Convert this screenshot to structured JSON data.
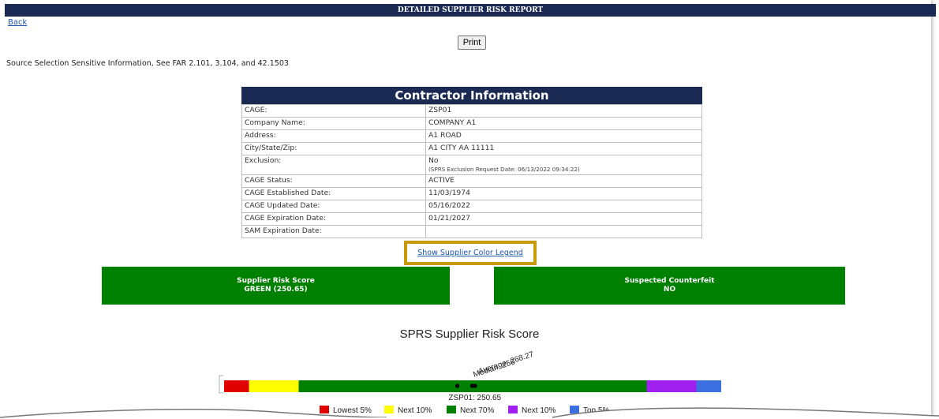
{
  "header": {
    "title": "DETAILED SUPPLIER RISK REPORT"
  },
  "nav": {
    "back_label": "Back",
    "print_label": "Print"
  },
  "notice": "Source Selection Sensitive Information, See FAR 2.101, 3.104, and 42.1503",
  "contractor": {
    "title": "Contractor Information",
    "rows": [
      {
        "label": "CAGE:",
        "value": "ZSP01"
      },
      {
        "label": "Company Name:",
        "value": "COMPANY A1"
      },
      {
        "label": "Address:",
        "value": "A1 ROAD"
      },
      {
        "label": "City/State/Zip:",
        "value": "A1 CITY AA 11111"
      },
      {
        "label": "Exclusion:",
        "value": "No",
        "note": "(SPRS Exclusion Request Date:  06/13/2022 09:34:22)"
      },
      {
        "label": "CAGE Status:",
        "value": "ACTIVE"
      },
      {
        "label": "CAGE Established Date:",
        "value": "11/03/1974"
      },
      {
        "label": "CAGE Updated Date:",
        "value": "05/16/2022"
      },
      {
        "label": "CAGE Expiration Date:",
        "value": "01/21/2027"
      },
      {
        "label": "SAM Expiration Date:",
        "value": ""
      }
    ]
  },
  "legend_link": "Show Supplier Color Legend",
  "scores": {
    "risk_title": "Supplier Risk Score",
    "risk_value": "GREEN (250.65)",
    "counterfeit_title": "Suspected Counterfeit",
    "counterfeit_value": "NO"
  },
  "chart_data": {
    "type": "bar",
    "title": "SPRS Supplier Risk Score",
    "segments": [
      {
        "name": "Lowest 5%",
        "fraction": 0.05,
        "color": "#e00000"
      },
      {
        "name": "Next 10%",
        "fraction": 0.1,
        "color": "#ffff00"
      },
      {
        "name": "Next 70%",
        "fraction": 0.7,
        "color": "#008000"
      },
      {
        "name": "Next 10%",
        "fraction": 0.1,
        "color": "#a020f0"
      },
      {
        "name": "Top 5%",
        "fraction": 0.05,
        "color": "#3c6fe0"
      }
    ],
    "markers": [
      {
        "label": "Median: 256",
        "position": 0.503
      },
      {
        "label": "Average: 268.27",
        "position": 0.51
      },
      {
        "label": "ZSP01: 250.65",
        "position": 0.499
      }
    ],
    "marker_dots": [
      0.469,
      0.499,
      0.505
    ]
  },
  "legend_items": [
    "Lowest 5%",
    "Next 10%",
    "Next 70%",
    "Next 10%",
    "Top 5%"
  ]
}
